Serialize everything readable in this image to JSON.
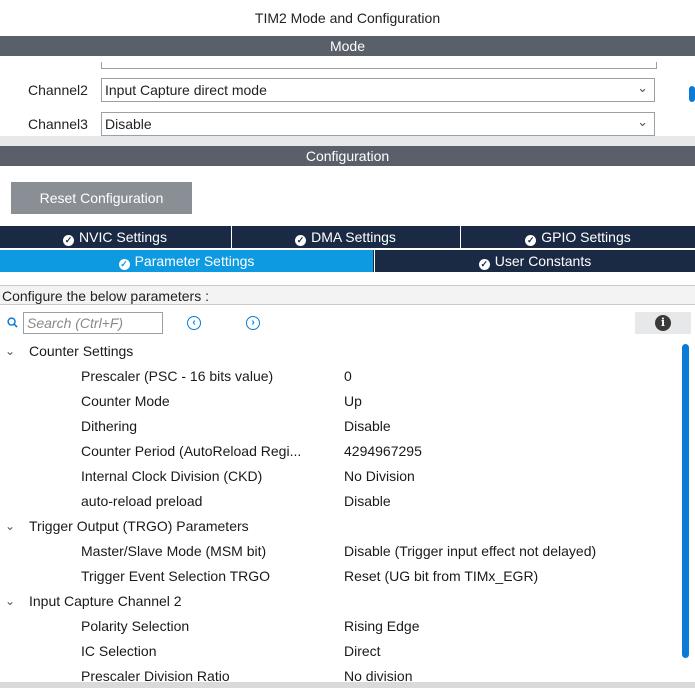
{
  "window_title": "TIM2 Mode and Configuration",
  "mode_section": {
    "header": "Mode",
    "channels": [
      {
        "label": "Channel2",
        "value": "Input Capture direct mode"
      },
      {
        "label": "Channel3",
        "value": "Disable"
      }
    ]
  },
  "config_section": {
    "header": "Configuration",
    "reset_button": "Reset Configuration",
    "tabs_row1": [
      "NVIC Settings",
      "DMA Settings",
      "GPIO Settings"
    ],
    "tabs_row2": [
      "Parameter Settings",
      "User Constants"
    ],
    "active_tab": "Parameter Settings",
    "configure_label": "Configure the below parameters :",
    "search_placeholder": "Search (Ctrl+F)"
  },
  "tree": {
    "groups": [
      {
        "label": "Counter Settings",
        "params": [
          {
            "name": "Prescaler (PSC - 16 bits value)",
            "value": "0"
          },
          {
            "name": "Counter Mode",
            "value": "Up"
          },
          {
            "name": "Dithering",
            "value": "Disable"
          },
          {
            "name": "Counter Period (AutoReload Regi...",
            "value": "4294967295"
          },
          {
            "name": "Internal Clock Division (CKD)",
            "value": "No Division"
          },
          {
            "name": "auto-reload preload",
            "value": "Disable"
          }
        ]
      },
      {
        "label": "Trigger Output (TRGO) Parameters",
        "params": [
          {
            "name": "Master/Slave Mode (MSM bit)",
            "value": "Disable (Trigger input effect not delayed)"
          },
          {
            "name": "Trigger Event Selection TRGO",
            "value": "Reset (UG bit from TIMx_EGR)"
          }
        ]
      },
      {
        "label": "Input Capture Channel 2",
        "params": [
          {
            "name": "Polarity Selection",
            "value": "Rising Edge"
          },
          {
            "name": "IC Selection",
            "value": "Direct"
          },
          {
            "name": "Prescaler Division Ratio",
            "value": "No division"
          }
        ]
      }
    ]
  },
  "icons": {
    "check": "check-circle-icon",
    "search": "search-icon",
    "prev": "chevron-left-circle-icon",
    "next": "chevron-right-circle-icon",
    "info": "info-icon",
    "expand": "chevron-down-icon",
    "dropdown": "chevron-down-icon"
  },
  "colors": {
    "header_bar": "#5a6069",
    "tab_bg": "#1b2a44",
    "tab_active": "#0d9ae0",
    "accent": "#0a7bd6"
  }
}
